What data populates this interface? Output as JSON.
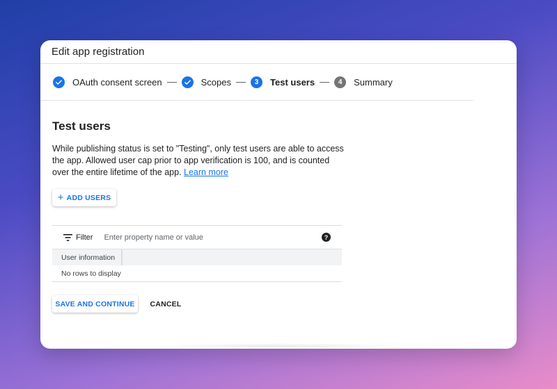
{
  "window": {
    "title": "Edit app registration"
  },
  "stepper": {
    "steps": [
      {
        "label": "OAuth consent screen",
        "state": "done"
      },
      {
        "label": "Scopes",
        "state": "done"
      },
      {
        "number": "3",
        "label": "Test users",
        "state": "active"
      },
      {
        "number": "4",
        "label": "Summary",
        "state": "pending"
      }
    ]
  },
  "section": {
    "title": "Test users",
    "description": "While publishing status is set to \"Testing\", only test users are able to access the app. Allowed user cap prior to app verification is 100, and is counted over the entire lifetime of the app.",
    "learn_more": "Learn more"
  },
  "add_users_button": "ADD USERS",
  "table": {
    "filter_label": "Filter",
    "filter_placeholder": "Enter property name or value",
    "filter_value": "",
    "columns": [
      "User information"
    ],
    "empty_text": "No rows to display"
  },
  "actions": {
    "save_label": "SAVE AND CONTINUE",
    "cancel_label": "CANCEL"
  },
  "colors": {
    "accent": "#1a73e8",
    "pending_step": "#757575"
  }
}
